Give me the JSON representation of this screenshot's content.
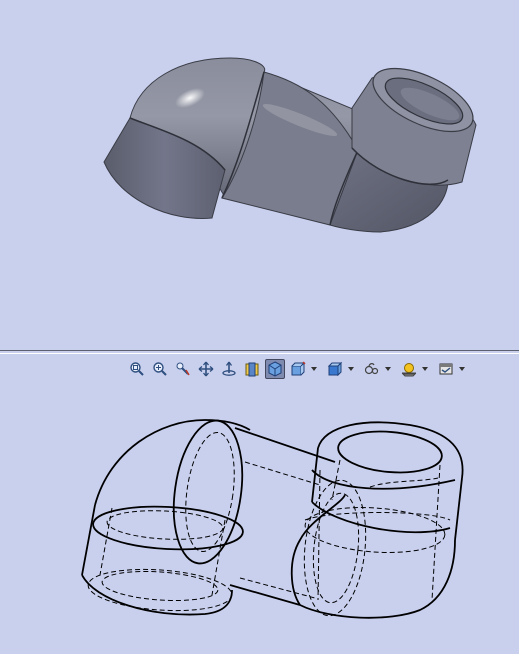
{
  "app": {
    "background": "#c9d0ee",
    "part_color": "#6e7180"
  },
  "viewports": [
    {
      "name": "top",
      "mode": "shaded"
    },
    {
      "name": "bottom",
      "mode": "hidden-lines-visible"
    }
  ],
  "toolbar": {
    "icons": [
      "zoom-to-fit-icon",
      "zoom-to-area-icon",
      "zoom-in-out-icon",
      "pan-icon",
      "rotate-view-icon",
      "section-view-icon",
      "view-orientation-icon",
      "display-style-icon",
      "hide-show-items-icon",
      "edit-appearance-icon",
      "apply-scene-icon",
      "view-settings-icon"
    ],
    "active_icon": "view-orientation-icon"
  }
}
